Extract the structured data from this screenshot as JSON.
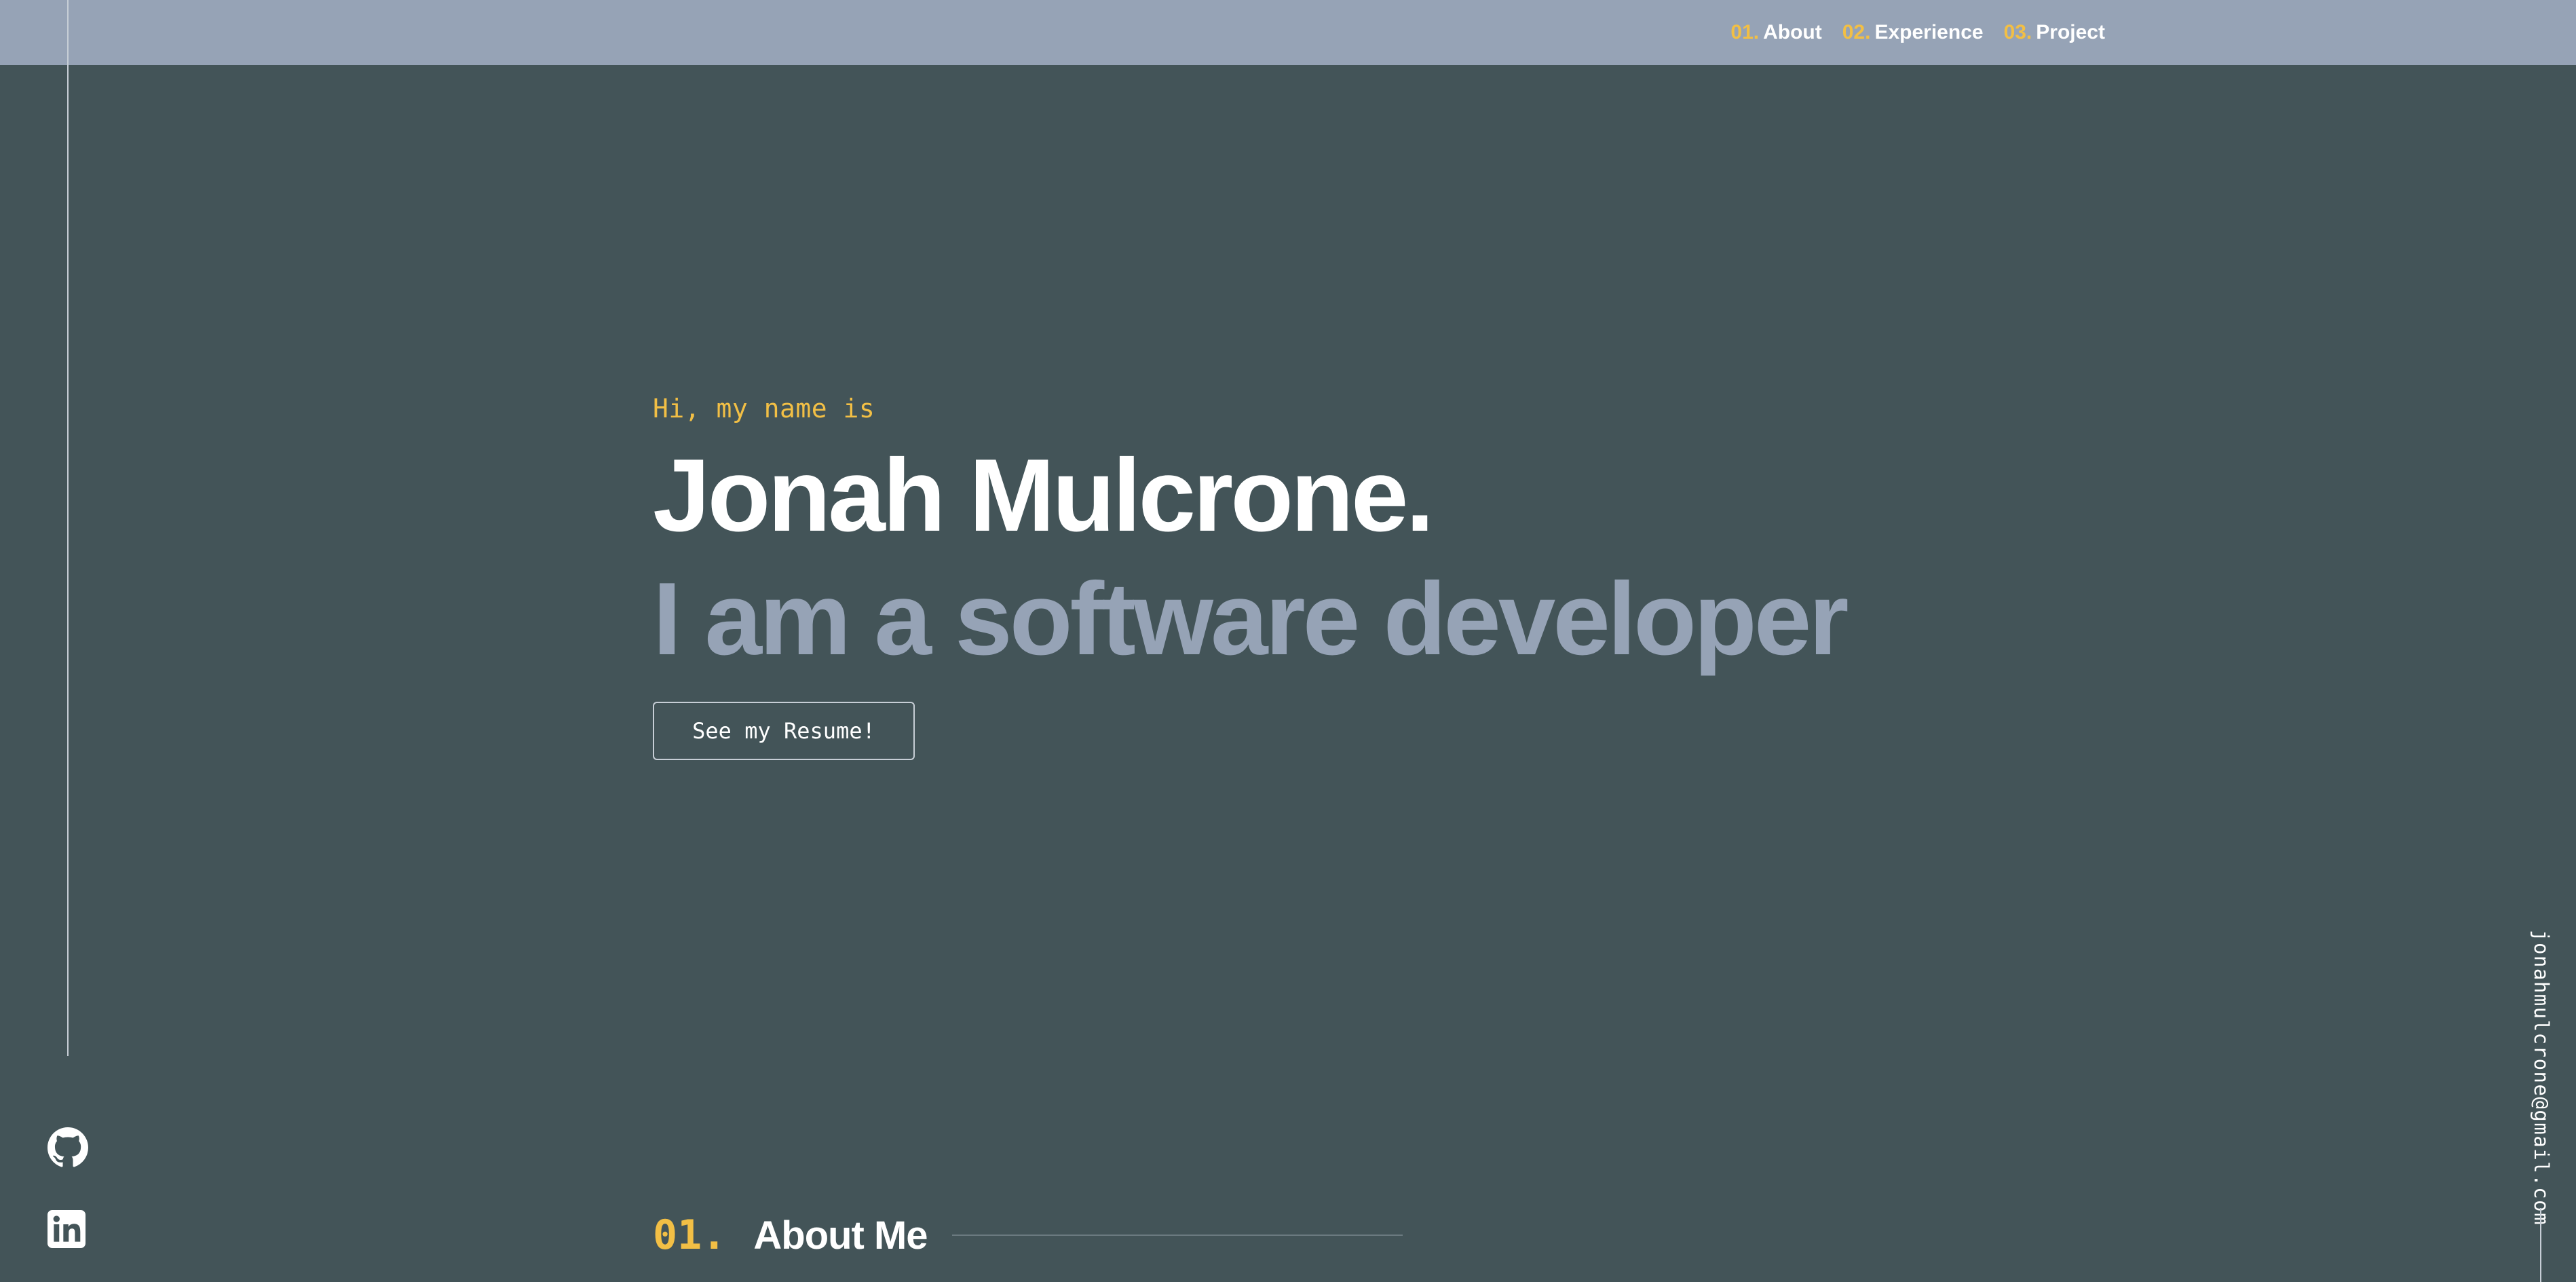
{
  "nav": {
    "items": [
      {
        "num": "01.",
        "label": "About"
      },
      {
        "num": "02.",
        "label": "Experience"
      },
      {
        "num": "03.",
        "label": "Project"
      }
    ]
  },
  "hero": {
    "greeting": "Hi, my name is",
    "name": "Jonah Mulcrone.",
    "tagline": "I am a software developer",
    "resume_button": "See my Resume!"
  },
  "social": {
    "github": "github-icon",
    "linkedin": "linkedin-icon"
  },
  "contact": {
    "email": "jonahmulcrone@gmail.com"
  },
  "about": {
    "num": "01.",
    "title": "About Me"
  },
  "colors": {
    "background": "#435458",
    "navbar": "#96a3b6",
    "accent": "#f2bf45",
    "muted": "#96a3b6",
    "text": "#ffffff"
  }
}
